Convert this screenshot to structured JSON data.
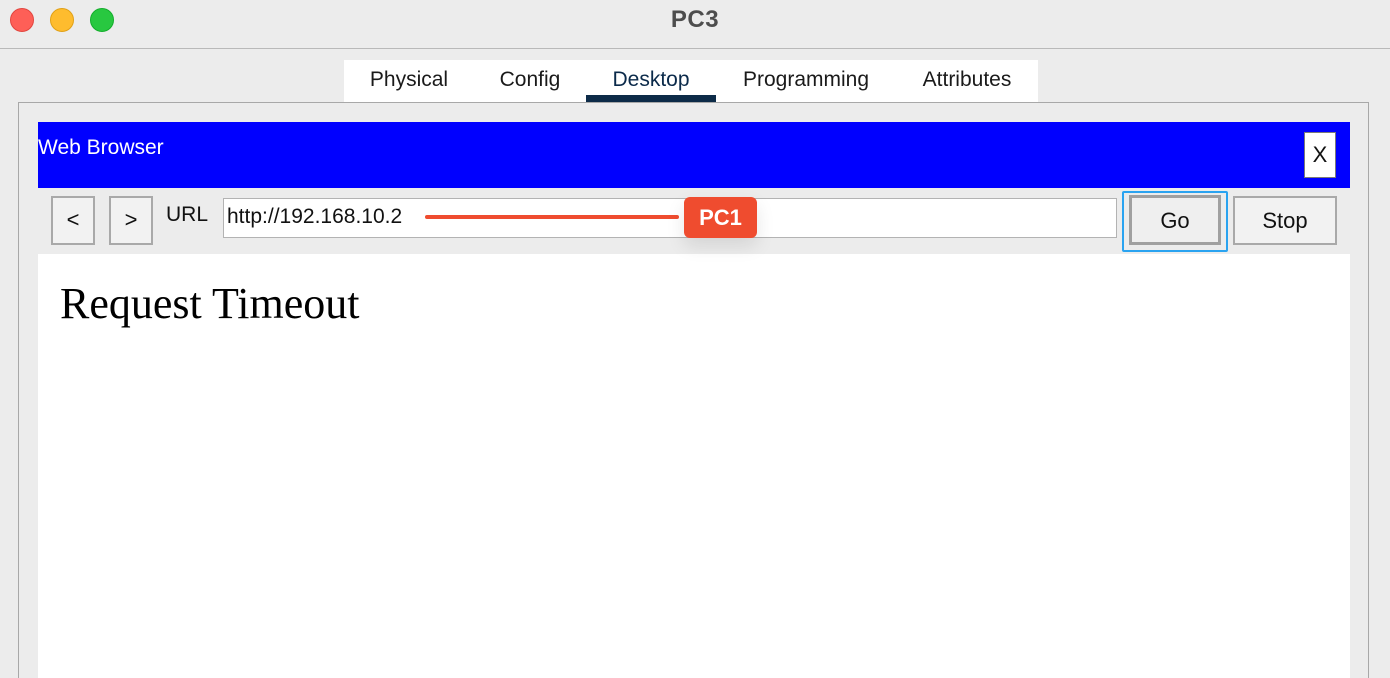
{
  "window": {
    "title": "PC3"
  },
  "tabs": [
    {
      "label": "Physical",
      "active": false
    },
    {
      "label": "Config",
      "active": false
    },
    {
      "label": "Desktop",
      "active": true
    },
    {
      "label": "Programming",
      "active": false
    },
    {
      "label": "Attributes",
      "active": false
    }
  ],
  "browser": {
    "title": "Web Browser",
    "close_label": "X",
    "back_label": "<",
    "forward_label": ">",
    "url_label": "URL",
    "url_value": "http://192.168.10.2",
    "go_label": "Go",
    "stop_label": "Stop",
    "page_message": "Request Timeout"
  },
  "annotation": {
    "label": "PC1",
    "color": "#ef4c2f"
  },
  "colors": {
    "header_blue": "#0000ff",
    "active_tab_underline": "#0d2b48",
    "focus_ring": "#2aa3f0"
  }
}
